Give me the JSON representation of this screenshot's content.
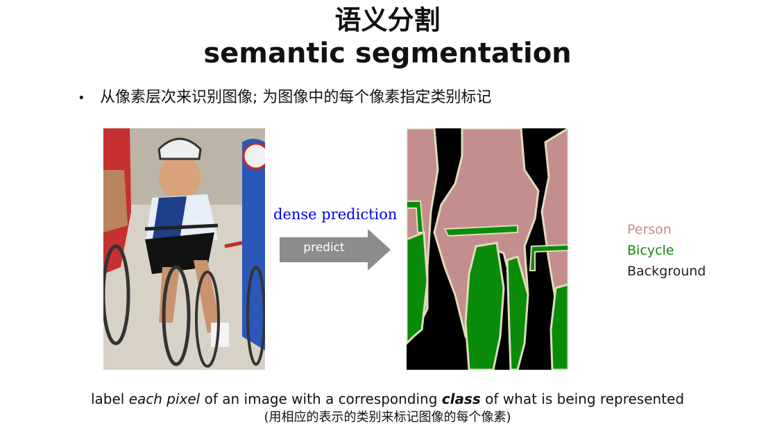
{
  "title": {
    "chinese": "语义分割",
    "english": "semantic segmentation"
  },
  "bullet": {
    "marker": "•",
    "text": "从像素层次来识别图像; 为图像中的每个像素指定类别标记"
  },
  "diagram": {
    "dense_label": "dense prediction",
    "arrow_label": "predict"
  },
  "legend": [
    {
      "label": "Person",
      "color": "#c48a8a"
    },
    {
      "label": "Bicycle",
      "color": "#0a8a0a"
    },
    {
      "label": "Background",
      "color": "#222222"
    }
  ],
  "caption": {
    "part1": "label ",
    "part2": "each pixel",
    "part3": " of an image with a corresponding ",
    "part4": "class",
    "part5": " of what is being represented",
    "chinese": "(用相应的表示的类别来标记图像的每个像素)"
  },
  "colors": {
    "person": "#c48e8c",
    "bicycle": "#0a8c0a",
    "background": "#000000",
    "boundary": "#e0dcc0",
    "arrow": "#8c8c8c",
    "dense_text": "#0000e6"
  }
}
